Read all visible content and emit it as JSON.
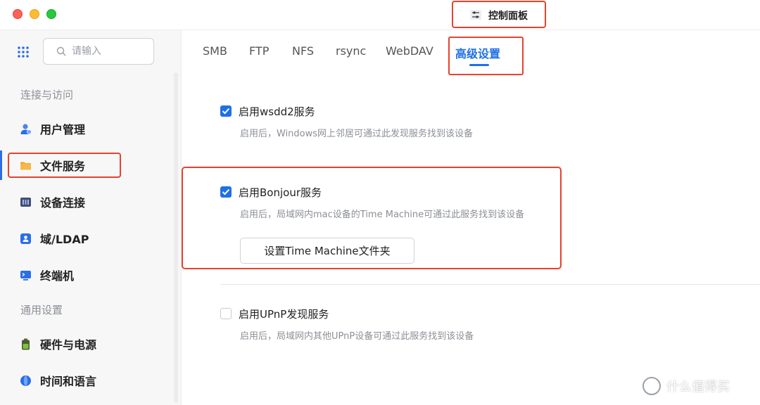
{
  "window": {
    "title": "控制面板"
  },
  "search": {
    "placeholder": "请输入",
    "value": ""
  },
  "sidebar": {
    "sections": [
      {
        "label": "连接与访问"
      },
      {
        "label": "通用设置"
      }
    ],
    "items": [
      {
        "label": "用户管理",
        "icon": "users-icon"
      },
      {
        "label": "文件服务",
        "icon": "folder-icon",
        "active": true
      },
      {
        "label": "设备连接",
        "icon": "device-icon"
      },
      {
        "label": "域/LDAP",
        "icon": "domain-icon"
      },
      {
        "label": "终端机",
        "icon": "terminal-icon"
      },
      {
        "label": "硬件与电源",
        "icon": "battery-icon"
      },
      {
        "label": "时间和语言",
        "icon": "globe-icon"
      }
    ]
  },
  "tabs": [
    {
      "label": "SMB"
    },
    {
      "label": "FTP"
    },
    {
      "label": "NFS"
    },
    {
      "label": "rsync"
    },
    {
      "label": "WebDAV"
    },
    {
      "label": "高级设置",
      "active": true
    }
  ],
  "options": [
    {
      "title": "启用wsdd2服务",
      "desc": "启用后，Windows网上邻居可通过此发现服务找到该设备",
      "checked": true
    },
    {
      "title": "启用Bonjour服务",
      "desc": "启用后，局域网内mac设备的Time Machine可通过此服务找到该设备",
      "checked": true,
      "button": "设置Time Machine文件夹"
    },
    {
      "title": "启用UPnP发现服务",
      "desc": "启用后，局域网内其他UPnP设备可通过此服务找到该设备",
      "checked": false
    }
  ],
  "watermark": {
    "text": "什么值得买"
  },
  "colors": {
    "accent": "#1f6fe5",
    "highlight": "#e8412c"
  }
}
